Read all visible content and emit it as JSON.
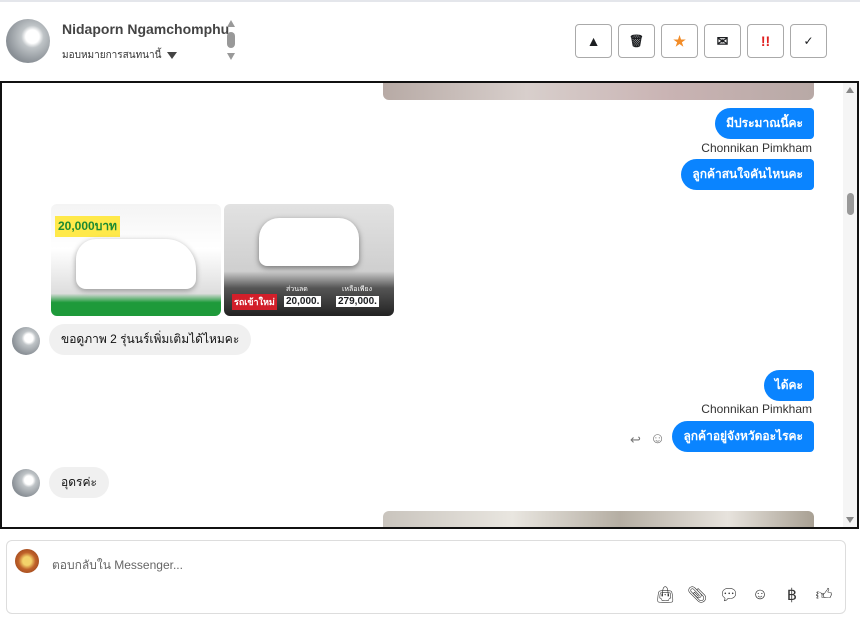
{
  "header": {
    "contact_name": "Nidaporn Ngamchomphu",
    "assign_label": "มอบหมายการสนทนานี้",
    "actions": [
      {
        "icon": "warning-icon",
        "glyph": "▲"
      },
      {
        "icon": "trash-icon",
        "glyph": "🗑"
      },
      {
        "icon": "star-icon",
        "glyph": "★",
        "color": "#f28c28"
      },
      {
        "icon": "envelope-open-icon",
        "glyph": "✉"
      },
      {
        "icon": "important-icon",
        "glyph": "!!",
        "color": "#e02020"
      },
      {
        "icon": "check-icon",
        "glyph": "✓"
      }
    ]
  },
  "messages": [
    {
      "dir": "out",
      "text": "มีประมาณนี้คะ"
    },
    {
      "sender": "Chonnikan Pimkham"
    },
    {
      "dir": "out",
      "text": "ลูกค้าสนใจคันไหนคะ"
    },
    {
      "dir": "in",
      "text": "ขอดูภาพ 2 รุ่นนร์เพิ่มเติมได้ไหมคะ"
    },
    {
      "dir": "out",
      "text": "ได้คะ"
    },
    {
      "sender": "Chonnikan Pimkham"
    },
    {
      "dir": "out",
      "text": "ลูกค้าอยู่จังหวัดอะไรคะ"
    },
    {
      "dir": "in",
      "text": "อุดรค่ะ"
    }
  ],
  "images": {
    "img1_text": "20,000บาท",
    "img2_price1": "20,000.",
    "img2_price2": "279,000.",
    "img2_tag": "รถเข้าใหม่",
    "img2_lbl1": "ส่วนลด",
    "img2_lbl2": "เหลือเพียง"
  },
  "composer": {
    "placeholder": "ตอบกลับใน Messenger..."
  },
  "accent": "#0a84ff"
}
